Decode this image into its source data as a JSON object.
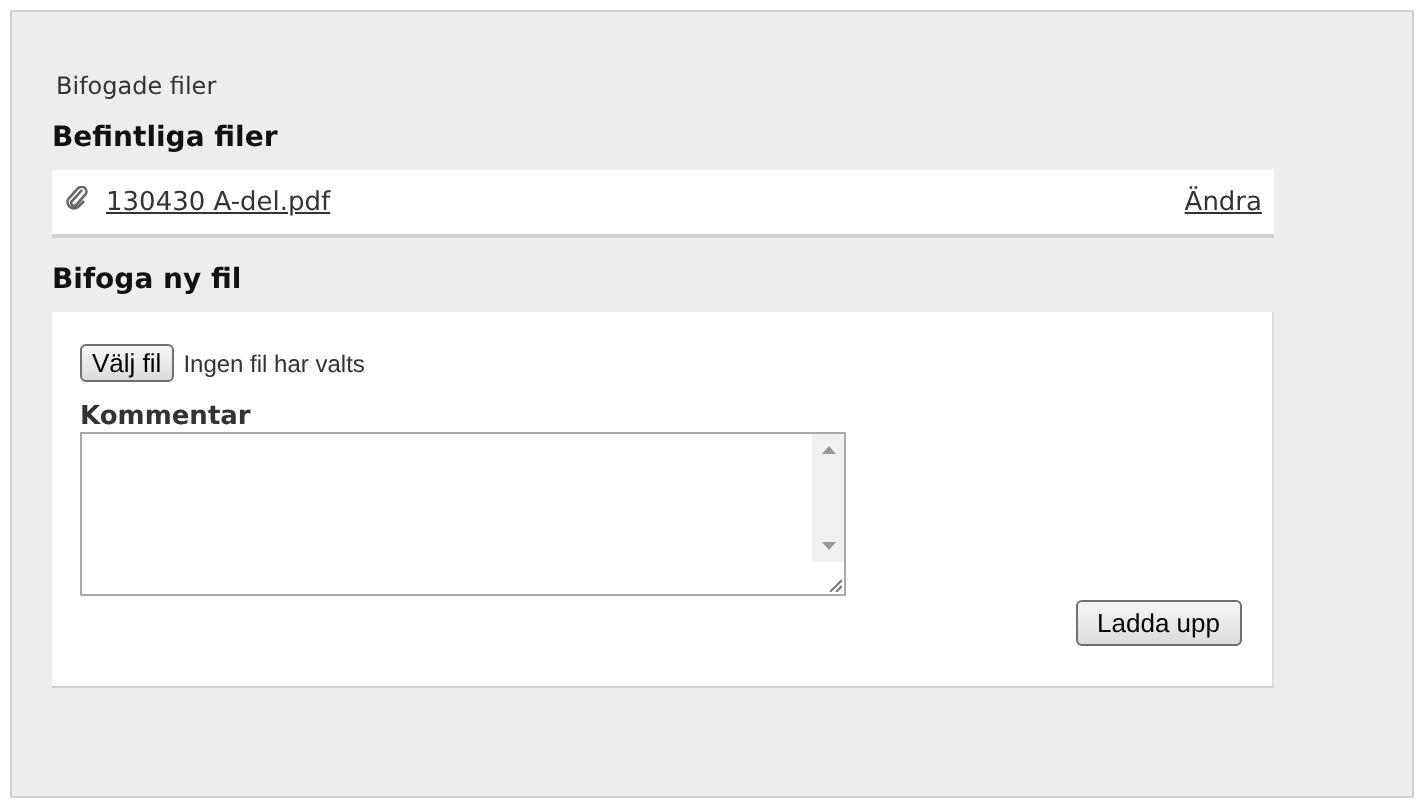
{
  "panel_title": "Bifogade filer",
  "existing": {
    "heading": "Befintliga filer",
    "files": [
      {
        "name": "130430 A-del.pdf",
        "action": "Ändra"
      }
    ]
  },
  "upload": {
    "heading": "Bifoga ny fil",
    "choose_button": "Välj fil",
    "no_file_text": "Ingen fil har valts",
    "comment_label": "Kommentar",
    "submit_button": "Ladda upp"
  }
}
